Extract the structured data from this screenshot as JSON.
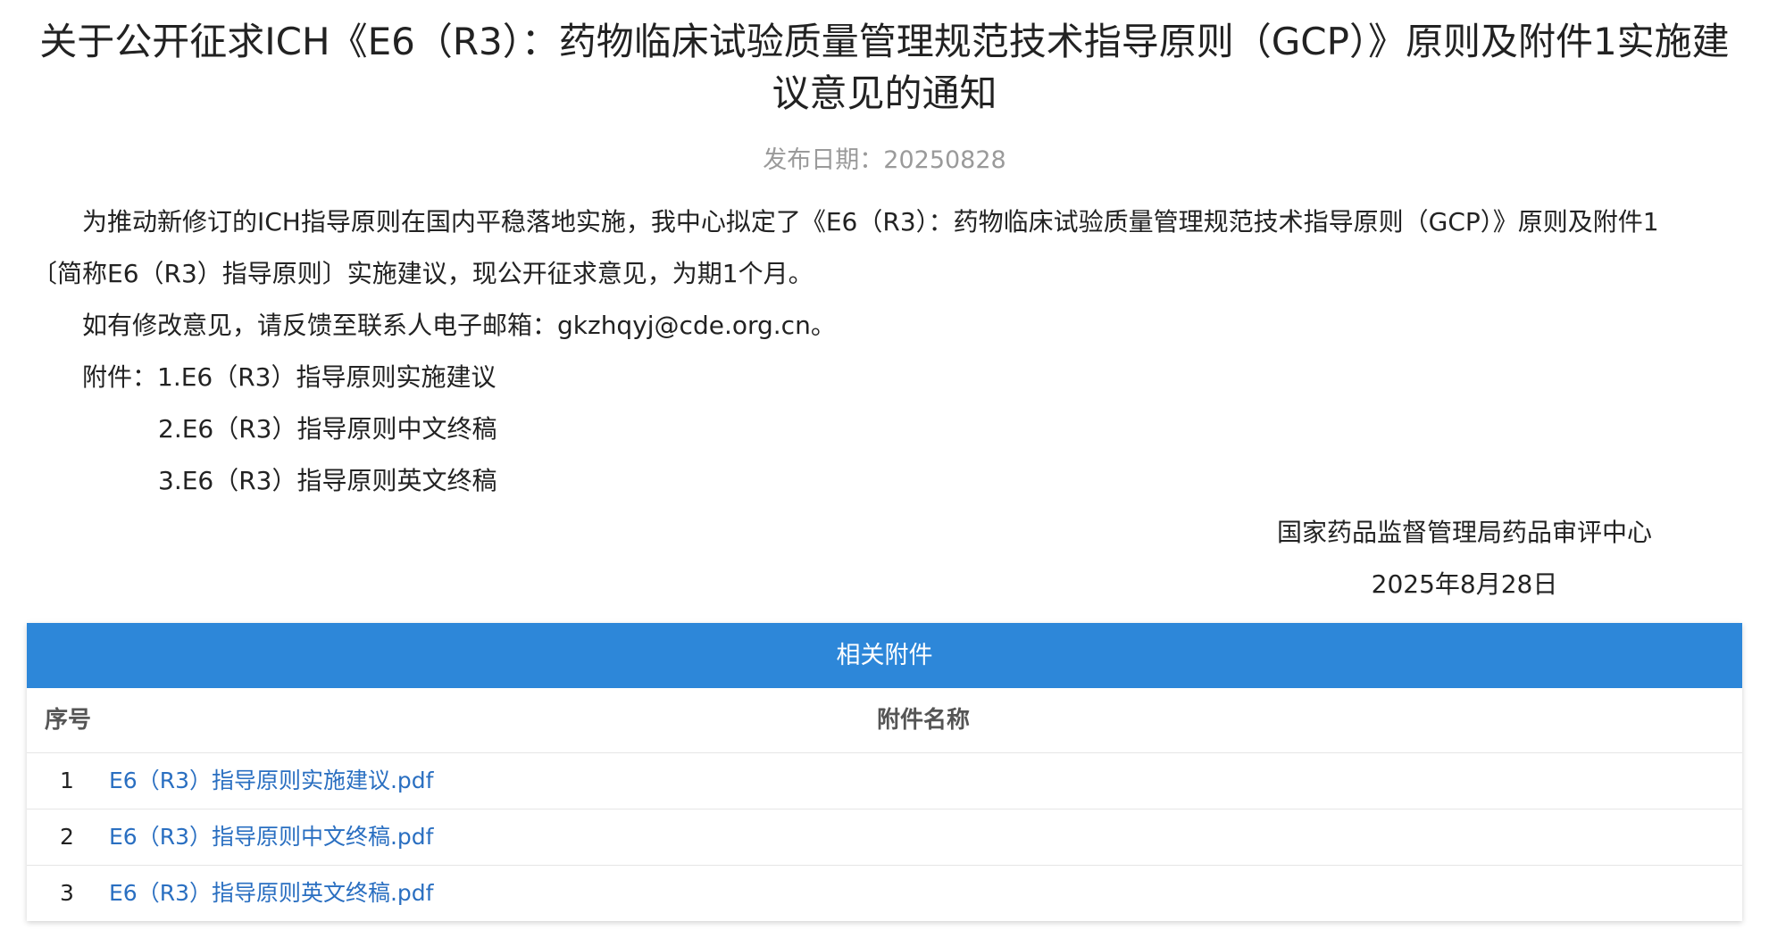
{
  "notice": {
    "title": "关于公开征求ICH《E6（R3）：药物临床试验质量管理规范技术指导原则（GCP）》原则及附件1实施建议意见的通知",
    "publish_date_label": "发布日期：20250828",
    "paragraph_1_line_1": "为推动新修订的ICH指导原则在国内平稳落地实施，我中心拟定了《E6（R3）：药物临床试验质量管理规范技术指导原则（GCP）》原则及附件1",
    "paragraph_1_line_2": "〔简称E6（R3）指导原则〕实施建议，现公开征求意见，为期1个月。",
    "paragraph_2": "如有修改意见，请反馈至联系人电子邮箱：gkzhqyj@cde.org.cn。",
    "attachments_label": "附件：1.E6（R3）指导原则实施建议",
    "attachment_2": "2.E6（R3）指导原则中文终稿",
    "attachment_3": "3.E6（R3）指导原则英文终稿",
    "signature_org": "国家药品监督管理局药品审评中心",
    "signature_date": "2025年8月28日"
  },
  "attachments_table": {
    "header": "相关附件",
    "col_index": "序号",
    "col_name": "附件名称",
    "rows": [
      {
        "index": "1",
        "file": "E6（R3）指导原则实施建议.pdf"
      },
      {
        "index": "2",
        "file": "E6（R3）指导原则中文终稿.pdf"
      },
      {
        "index": "3",
        "file": "E6（R3）指导原则英文终稿.pdf"
      }
    ]
  },
  "colors": {
    "table_header_bg": "#2d87d9",
    "link": "#2a6fc1",
    "date_text": "#9a9a9a"
  }
}
